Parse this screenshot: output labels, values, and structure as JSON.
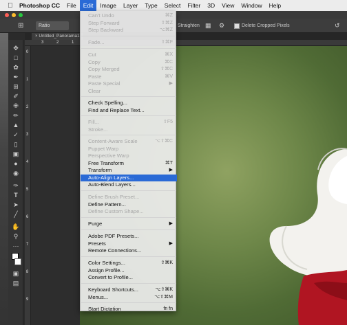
{
  "menubar": {
    "apple": "",
    "app": "Photoshop CC",
    "items": [
      "File",
      "Edit",
      "Image",
      "Layer",
      "Type",
      "Select",
      "Filter",
      "3D",
      "View",
      "Window",
      "Help"
    ]
  },
  "options": {
    "ratio": "Ratio",
    "straighten": "Straighten",
    "delete_cropped": "Delete Cropped Pixels"
  },
  "document": {
    "tab_title": "Untitled_Panorama1"
  },
  "ruler": {
    "h_ticks": [
      "3",
      "2",
      "1",
      "0"
    ],
    "v_ticks": [
      "0",
      "1",
      "2",
      "3",
      "4",
      "5",
      "6",
      "7",
      "8",
      "9"
    ]
  },
  "edit_menu": {
    "items": [
      {
        "label": "Can't Undo",
        "shortcut": "⌘Z",
        "disabled": true
      },
      {
        "label": "Step Forward",
        "shortcut": "⇧⌘Z",
        "disabled": true
      },
      {
        "label": "Step Backward",
        "shortcut": "⌥⌘Z",
        "disabled": true
      },
      {
        "label": "Fade...",
        "shortcut": "⇧⌘F",
        "disabled": true
      },
      {
        "label": "Cut",
        "shortcut": "⌘X",
        "disabled": true
      },
      {
        "label": "Copy",
        "shortcut": "⌘C",
        "disabled": true
      },
      {
        "label": "Copy Merged",
        "shortcut": "⇧⌘C",
        "disabled": true
      },
      {
        "label": "Paste",
        "shortcut": "⌘V",
        "disabled": true
      },
      {
        "label": "Paste Special",
        "shortcut": "▶",
        "disabled": true
      },
      {
        "label": "Clear",
        "shortcut": "",
        "disabled": true
      },
      {
        "label": "Check Spelling...",
        "shortcut": "",
        "disabled": false
      },
      {
        "label": "Find and Replace Text...",
        "shortcut": "",
        "disabled": false
      },
      {
        "label": "Fill...",
        "shortcut": "⇧F5",
        "disabled": true
      },
      {
        "label": "Stroke...",
        "shortcut": "",
        "disabled": true
      },
      {
        "label": "Content-Aware Scale",
        "shortcut": "⌥⇧⌘C",
        "disabled": true
      },
      {
        "label": "Puppet Warp",
        "shortcut": "",
        "disabled": true
      },
      {
        "label": "Perspective Warp",
        "shortcut": "",
        "disabled": true
      },
      {
        "label": "Free Transform",
        "shortcut": "⌘T",
        "disabled": false
      },
      {
        "label": "Transform",
        "shortcut": "▶",
        "disabled": false
      },
      {
        "label": "Auto-Align Layers...",
        "shortcut": "",
        "disabled": false,
        "highlighted": true
      },
      {
        "label": "Auto-Blend Layers...",
        "shortcut": "",
        "disabled": false
      },
      {
        "label": "Define Brush Preset...",
        "shortcut": "",
        "disabled": true
      },
      {
        "label": "Define Pattern...",
        "shortcut": "",
        "disabled": false
      },
      {
        "label": "Define Custom Shape...",
        "shortcut": "",
        "disabled": true
      },
      {
        "label": "Purge",
        "shortcut": "▶",
        "disabled": false
      },
      {
        "label": "Adobe PDF Presets...",
        "shortcut": "",
        "disabled": false
      },
      {
        "label": "Presets",
        "shortcut": "▶",
        "disabled": false
      },
      {
        "label": "Remote Connections...",
        "shortcut": "",
        "disabled": false
      },
      {
        "label": "Color Settings...",
        "shortcut": "⇧⌘K",
        "disabled": false
      },
      {
        "label": "Assign Profile...",
        "shortcut": "",
        "disabled": false
      },
      {
        "label": "Convert to Profile...",
        "shortcut": "",
        "disabled": false
      },
      {
        "label": "Keyboard Shortcuts...",
        "shortcut": "⌥⇧⌘K",
        "disabled": false
      },
      {
        "label": "Menus...",
        "shortcut": "⌥⇧⌘M",
        "disabled": false
      },
      {
        "label": "Start Dictation",
        "shortcut": "fn fn",
        "disabled": false
      }
    ]
  },
  "colors": {
    "highlight": "#2a6ad6",
    "menu_bg": "#ededed",
    "disabled_text": "#a7a7a7"
  }
}
